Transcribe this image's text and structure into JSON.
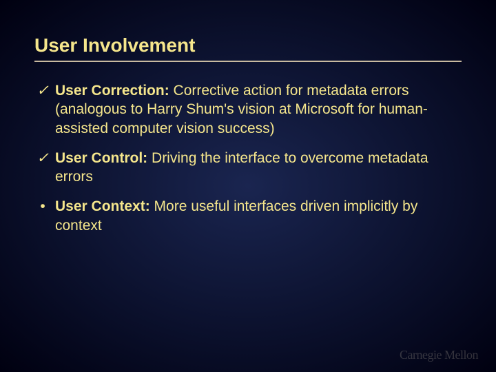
{
  "title": "User Involvement",
  "bullets": [
    {
      "marker": "✓",
      "markerClass": "check",
      "bold": "User Correction:",
      "rest": " Corrective action for metadata errors (analogous to Harry Shum's vision at Microsoft for human-assisted computer vision success)"
    },
    {
      "marker": "✓",
      "markerClass": "check",
      "bold": "User Control:",
      "rest": " Driving the interface to overcome metadata errors"
    },
    {
      "marker": "•",
      "markerClass": "",
      "bold": "User Context:",
      "rest": " More useful interfaces driven implicitly by context"
    }
  ],
  "footer": "Carnegie Mellon"
}
